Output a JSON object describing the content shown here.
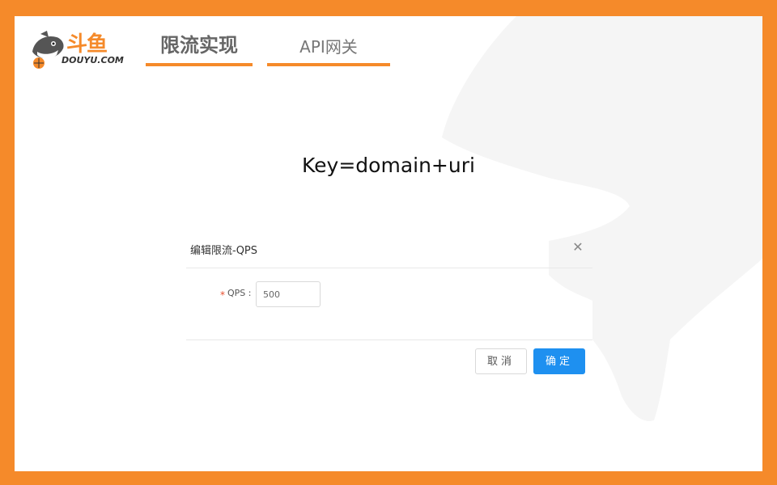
{
  "brand": {
    "name_cn": "斗鱼",
    "name_en": "DOUYU.COM",
    "accent_color": "#f58a2a"
  },
  "tabs": [
    {
      "label": "限流实现",
      "active": true
    },
    {
      "label": "API网关",
      "active": false
    }
  ],
  "main": {
    "heading": "Key=domain+uri"
  },
  "dialog": {
    "title": "编辑限流-QPS",
    "close_icon": "close-icon",
    "field": {
      "required_mark": "*",
      "label": "QPS :",
      "value": "500"
    },
    "buttons": {
      "cancel": "取消",
      "ok": "确定"
    },
    "primary_color": "#1e90f0"
  }
}
